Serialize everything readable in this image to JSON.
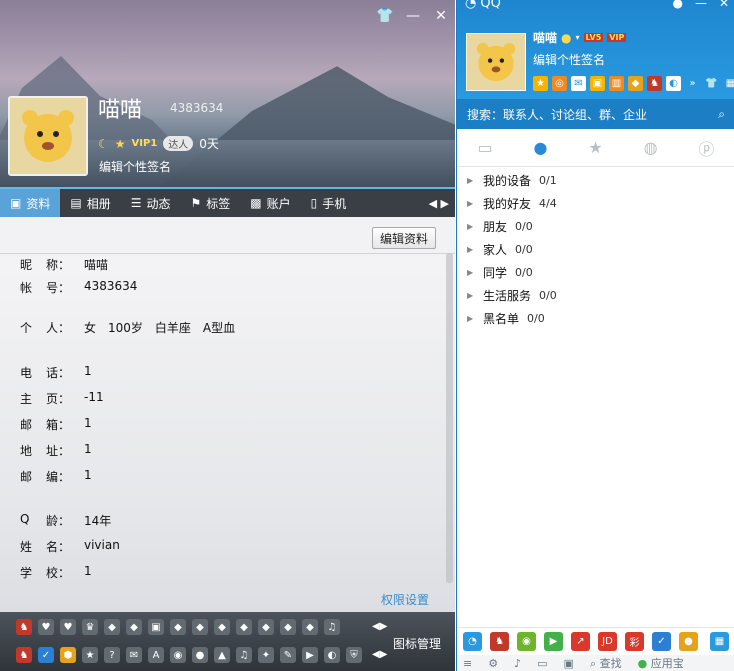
{
  "profile_window": {
    "title_icons": [
      "skin-icon",
      "minimize-icon",
      "close-icon"
    ],
    "nickname": "喵喵",
    "qq_number": "4383634",
    "badges": {
      "vip_label": "VIP1",
      "daren_label": "达人",
      "days": "0天"
    },
    "signature": "编辑个性签名",
    "tabs": [
      {
        "icon": "profile-card-icon",
        "label": "资料",
        "active": true
      },
      {
        "icon": "album-icon",
        "label": "相册"
      },
      {
        "icon": "feed-icon",
        "label": "动态"
      },
      {
        "icon": "tag-icon",
        "label": "标签"
      },
      {
        "icon": "account-icon",
        "label": "账户"
      },
      {
        "icon": "phone-icon",
        "label": "手机"
      }
    ],
    "edit_button": "编辑资料",
    "info": [
      {
        "key": [
          "昵",
          "称："
        ],
        "value": "喵喵"
      },
      {
        "key": [
          "帐",
          "号："
        ],
        "value": "4383634"
      },
      {
        "key": [
          "个",
          "人："
        ],
        "value": "女　100岁　白羊座　A型血"
      },
      {
        "key": [
          "电",
          "话："
        ],
        "value": "1"
      },
      {
        "key": [
          "主",
          "页："
        ],
        "value": "-11"
      },
      {
        "key": [
          "邮",
          "箱："
        ],
        "value": "1"
      },
      {
        "key": [
          "地",
          "址："
        ],
        "value": "1"
      },
      {
        "key": [
          "邮",
          "编："
        ],
        "value": "1"
      },
      {
        "key": [
          "Q",
          "龄："
        ],
        "value": "14年"
      },
      {
        "key": [
          "姓",
          "名："
        ],
        "value": "vivian"
      },
      {
        "key": [
          "学",
          "校："
        ],
        "value": "1"
      }
    ],
    "permission_link": "权限设置",
    "icon_manager": "图标管理"
  },
  "qq_panel": {
    "title": "QQ",
    "nickname": "喵喵",
    "level_badge": "LV5",
    "vip_badge": "VIP",
    "signature": "编辑个性签名",
    "search_placeholder": "搜索：联系人、讨论组、群、企业",
    "category_tabs": [
      "message-icon",
      "contacts-icon",
      "favorite-icon",
      "group-icon",
      "discussion-icon"
    ],
    "groups": [
      {
        "name": "我的设备",
        "count": "0/1"
      },
      {
        "name": "我的好友",
        "count": "4/4"
      },
      {
        "name": "朋友",
        "count": "0/0"
      },
      {
        "name": "家人",
        "count": "0/0"
      },
      {
        "name": "同学",
        "count": "0/0"
      },
      {
        "name": "生活服务",
        "count": "0/0"
      },
      {
        "name": "黑名单",
        "count": "0/0"
      }
    ],
    "footer": {
      "find": "查找",
      "app_store": "应用宝"
    }
  },
  "colors": {
    "qq_blue": "#2a9ae0",
    "tab_active": "#5aa3d8",
    "link": "#3a8bc9"
  }
}
